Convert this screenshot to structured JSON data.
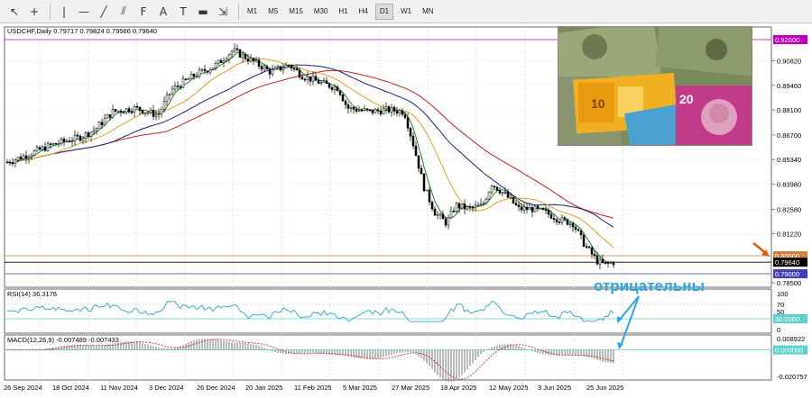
{
  "toolbar": {
    "tools": [
      {
        "name": "cursor-icon",
        "glyph": "↖"
      },
      {
        "name": "crosshair-icon",
        "glyph": "+"
      },
      {
        "name": "vertical-line-icon",
        "glyph": "|"
      },
      {
        "name": "horizontal-line-icon",
        "glyph": "—"
      },
      {
        "name": "trendline-icon",
        "glyph": "╱"
      },
      {
        "name": "channel-icon",
        "glyph": "⫽"
      },
      {
        "name": "fibonacci-icon",
        "glyph": "F"
      },
      {
        "name": "text-icon",
        "glyph": "A"
      },
      {
        "name": "label-icon",
        "glyph": "T"
      },
      {
        "name": "shapes-icon",
        "glyph": "▬"
      },
      {
        "name": "arrows-icon",
        "glyph": "⇲"
      }
    ],
    "timeframes": [
      "M1",
      "M5",
      "M15",
      "M30",
      "H1",
      "H4",
      "D1",
      "W1",
      "MN"
    ],
    "active_timeframe": "D1"
  },
  "chart": {
    "symbol_info": "USDCHF,Daily  0.79717 0.79824 0.79566 0.79640",
    "price_axis": [
      "0.92000",
      "0.90820",
      "0.89460",
      "0.88100",
      "0.86700",
      "0.85340",
      "0.83980",
      "0.82580",
      "0.81220",
      "0.80000",
      "0.79640",
      "0.79000",
      "0.78500"
    ],
    "highlight_levels": [
      {
        "label": "0.92000",
        "color": "#c000c0"
      },
      {
        "label": "0.80000",
        "color": "#d08040"
      },
      {
        "label": "0.79640",
        "color": "#000000"
      },
      {
        "label": "0.79000",
        "color": "#4040c0"
      }
    ],
    "date_axis": [
      "26 Sep 2024",
      "18 Oct 2024",
      "11 Nov 2024",
      "3 Dec 2024",
      "26 Dec 2024",
      "20 Jan 2025",
      "11 Feb 2025",
      "5 Mar 2025",
      "27 Mar 2025",
      "18 Apr 2025",
      "12 May 2025",
      "3 Jun 2025",
      "25 Jun 2025"
    ]
  },
  "rsi": {
    "label": "RSI(14) 36.3176",
    "axis": [
      "100",
      "70",
      "50",
      "30",
      "0"
    ],
    "level_label": "30.0000"
  },
  "macd": {
    "label": "MACD(12,26,9) -0.007489 -0.007433",
    "axis_top": "0.008922",
    "axis_zero": "0.000000",
    "axis_bottom": "-0.020757"
  },
  "annotation": {
    "text": "отрицательны",
    "color": "#2aa7e0"
  },
  "colors": {
    "ma_fast": "#1a8a1a",
    "ma_mid": "#e0a020",
    "ma_slow_blue": "#202080",
    "ma_slow_red": "#c02020",
    "candle": "#000000",
    "orange_arrow": "#d06010"
  }
}
